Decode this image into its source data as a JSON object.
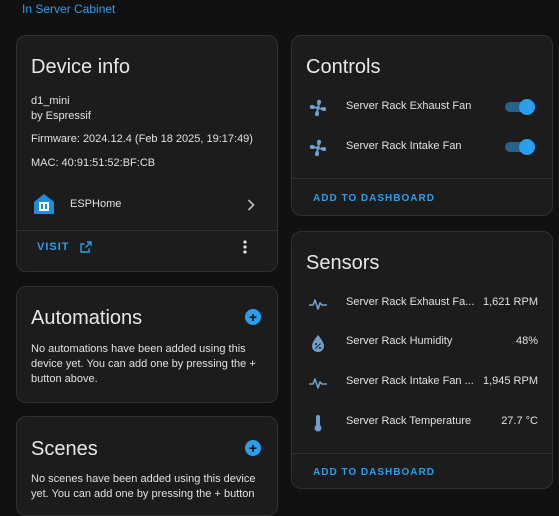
{
  "header": {
    "area_link": "In Server Cabinet"
  },
  "device_info": {
    "title": "Device info",
    "model": "d1_mini",
    "manufacturer": "by Espressif",
    "firmware": "Firmware: 2024.12.4 (Feb 18 2025, 19:17:49)",
    "mac": "MAC: 40:91:51:52:BF:CB",
    "integration": "ESPHome",
    "visit_label": "VISIT"
  },
  "automations": {
    "title": "Automations",
    "text": "No automations have been added using this device yet. You can add one by pressing the + button above."
  },
  "scenes": {
    "title": "Scenes",
    "text": "No scenes have been added using this device yet. You can add one by pressing the + button"
  },
  "controls": {
    "title": "Controls",
    "items": [
      {
        "label": "Server Rack Exhaust Fan",
        "icon": "fan-icon",
        "state": "on"
      },
      {
        "label": "Server Rack Intake Fan",
        "icon": "fan-icon",
        "state": "on"
      }
    ],
    "add_label": "ADD TO DASHBOARD"
  },
  "sensors": {
    "title": "Sensors",
    "items": [
      {
        "label": "Server Rack Exhaust Fa...",
        "value": "1,621 RPM",
        "icon": "pulse-icon"
      },
      {
        "label": "Server Rack Humidity",
        "value": "48%",
        "icon": "water-percent-icon"
      },
      {
        "label": "Server Rack Intake Fan ...",
        "value": "1,945 RPM",
        "icon": "pulse-icon"
      },
      {
        "label": "Server Rack Temperature",
        "value": "27.7 °C",
        "icon": "thermometer-icon"
      }
    ],
    "add_label": "ADD TO DASHBOARD"
  },
  "colors": {
    "accent": "#2a9eec",
    "card_bg": "#1c1c1c",
    "page_bg": "#111111",
    "icon": "#6f9fca"
  }
}
